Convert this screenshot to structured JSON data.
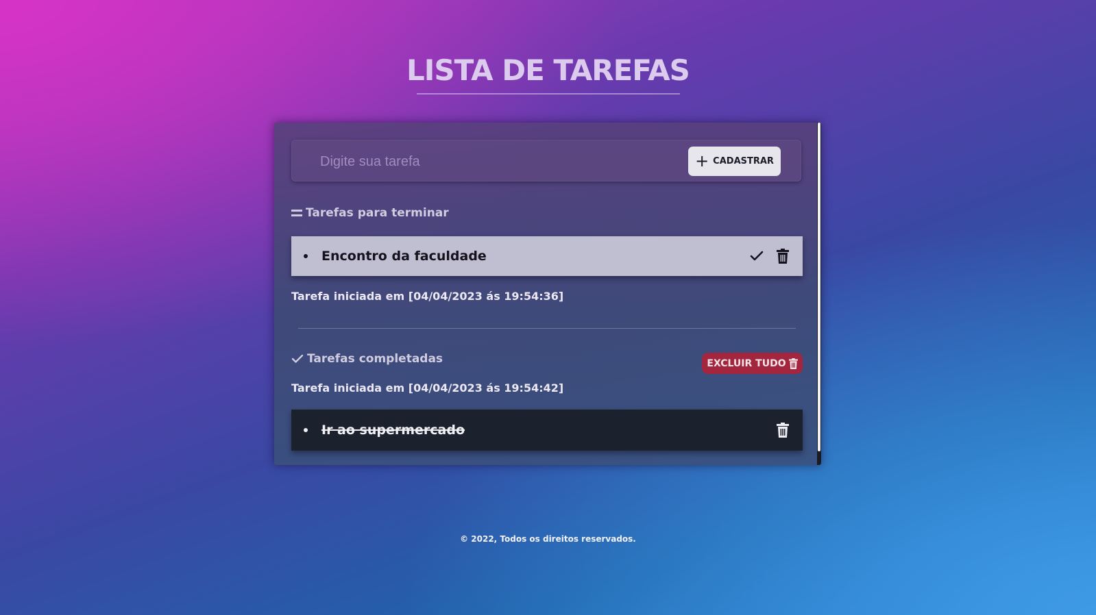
{
  "app": {
    "title": "LISTA DE TAREFAS"
  },
  "form": {
    "input_value": "",
    "input_placeholder": "Digite sua tarefa",
    "add_label": "CADASTRAR"
  },
  "pending": {
    "heading": "Tarefas para terminar",
    "tasks": [
      {
        "text": "Encontro da faculdade",
        "timestamp": "Tarefa iniciada em [04/04/2023 ás 19:54:36]"
      }
    ]
  },
  "completed": {
    "heading": "Tarefas completadas",
    "clear_label": "EXCLUIR TUDO",
    "tasks": [
      {
        "text": "Ir ao supermercado",
        "timestamp": "Tarefa iniciada em [04/04/2023 ás 19:54:42]"
      }
    ]
  },
  "footer": {
    "text": "© 2022, Todos os direitos reservados."
  },
  "colors": {
    "clear_button": "#a4263e",
    "pending_task_bg": "#c0bfd1",
    "completed_task_bg": "#1b222d",
    "add_button_bg": "#e6e6ec"
  },
  "icons": {
    "add": "plus-icon",
    "pending_section": "equals-icon",
    "completed_section": "check-icon",
    "complete_task": "check-icon",
    "delete_task": "trash-icon"
  }
}
